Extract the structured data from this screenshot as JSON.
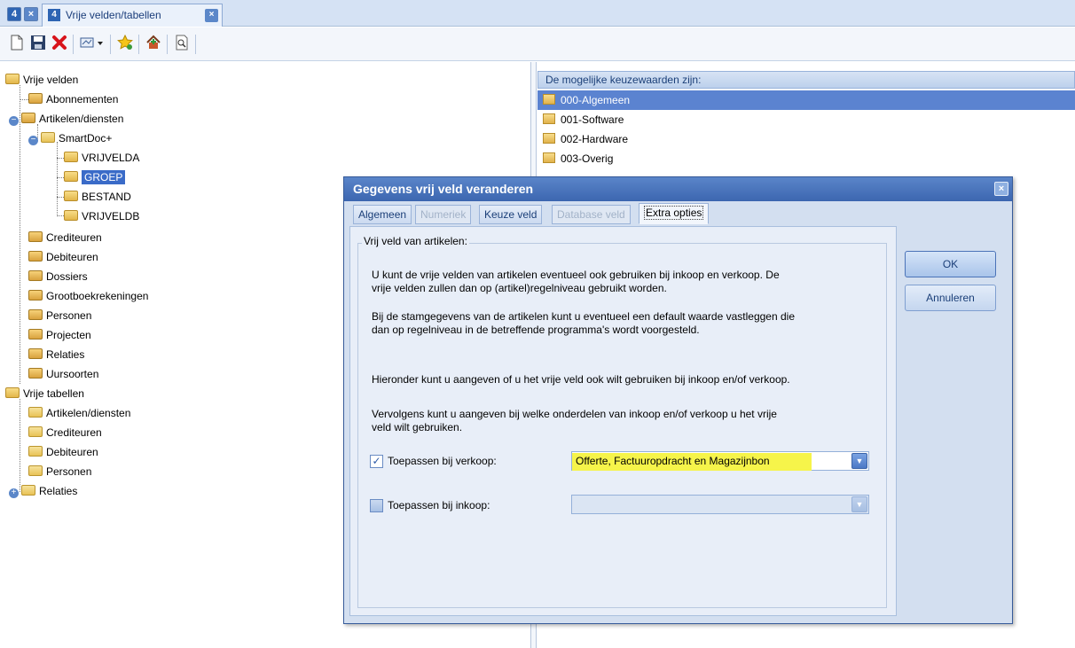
{
  "window": {
    "tab_title": "Vrije velden/tabellen",
    "tab_close": "x"
  },
  "toolbar": {
    "icons": [
      "new-icon",
      "save-icon",
      "delete-icon",
      "dropdown-icon",
      "favorite-icon",
      "home-icon",
      "preview-icon"
    ]
  },
  "tree": {
    "root1": "Vrije velden",
    "items_a": [
      "Abonnementen",
      "Artikelen/diensten"
    ],
    "smartdoc": "SmartDoc+",
    "smartdoc_children": [
      "VRIJVELDA",
      "GROEP",
      "BESTAND",
      "VRIJVELDB"
    ],
    "items_b": [
      "Crediteuren",
      "Debiteuren",
      "Dossiers",
      "Grootboekrekeningen",
      "Personen",
      "Projecten",
      "Relaties",
      "Uursoorten"
    ],
    "root2": "Vrije tabellen",
    "tables": [
      "Artikelen/diensten",
      "Crediteuren",
      "Debiteuren",
      "Personen",
      "Relaties"
    ]
  },
  "values_list": {
    "header": "De mogelijke keuzewaarden zijn:",
    "items": [
      "000-Algemeen",
      "001-Software",
      "002-Hardware",
      "003-Overig"
    ]
  },
  "dialog": {
    "title": "Gegevens vrij veld veranderen",
    "close": "x",
    "tabs": [
      "Algemeen",
      "Numeriek",
      "Keuze veld",
      "Database veld",
      "Extra opties"
    ],
    "group_title": "Vrij veld van artikelen:",
    "para1_l1": "U kunt de vrije velden van artikelen eventueel ook gebruiken bij inkoop en verkoop. De",
    "para1_l2": "vrije velden zullen dan op (artikel)regelniveau gebruikt worden.",
    "para2_l1": "Bij de stamgegevens van de artikelen kunt u eventueel een default waarde vastleggen die",
    "para2_l2": "dan op regelniveau in de betreffende programma's wordt voorgesteld.",
    "para3": "Hieronder kunt u aangeven of u het vrije veld ook wilt gebruiken bij inkoop en/of verkoop.",
    "para4_l1": "Vervolgens kunt u aangeven bij welke onderdelen van inkoop en/of verkoop u het vrije",
    "para4_l2": "veld wilt gebruiken.",
    "verkoop_label": "Toepassen bij verkoop:",
    "verkoop_checked": true,
    "verkoop_value": "Offerte, Factuuropdracht en Magazijnbon",
    "inkoop_label": "Toepassen bij inkoop:",
    "inkoop_checked": false,
    "inkoop_value": "",
    "ok_label": "OK",
    "cancel_label": "Annuleren",
    "highlight_color": "#f6f44a"
  }
}
